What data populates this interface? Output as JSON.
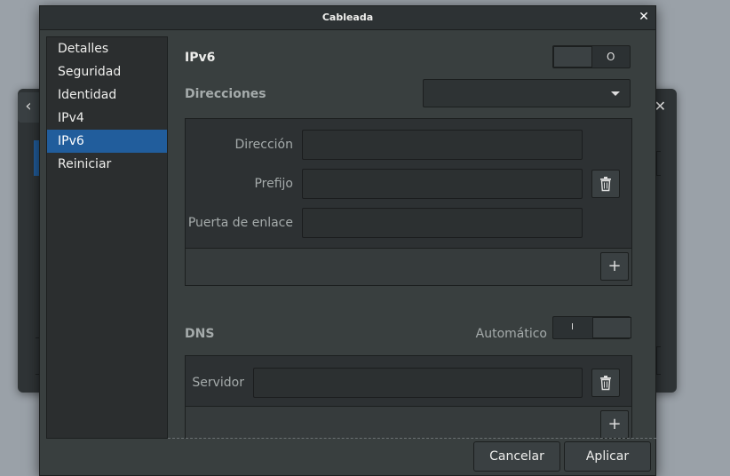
{
  "dialog": {
    "title": "Cableada",
    "close_glyph": "✕"
  },
  "sidebar": {
    "items": [
      {
        "label": "Detalles"
      },
      {
        "label": "Seguridad"
      },
      {
        "label": "Identidad"
      },
      {
        "label": "IPv4"
      },
      {
        "label": "IPv6"
      },
      {
        "label": "Reiniciar"
      }
    ],
    "selected": "IPv6"
  },
  "ipv6": {
    "title": "IPv6",
    "switch_state": "off",
    "switch_off_glyph": "O"
  },
  "addresses": {
    "title": "Direcciones",
    "method_value": "",
    "address_label": "Dirección",
    "address_value": "",
    "prefix_label": "Prefijo",
    "prefix_value": "",
    "gateway_label": "Puerta de enlace",
    "gateway_value": "",
    "add_glyph": "+"
  },
  "dns": {
    "title": "DNS",
    "auto_label": "Automático",
    "auto_state": "on",
    "auto_on_glyph": "I",
    "server_label": "Servidor",
    "server_value": "",
    "add_glyph": "+"
  },
  "footer": {
    "cancel_label": "Cancelar",
    "apply_label": "Aplicar"
  },
  "background_window": {
    "back_glyph": "‹",
    "close_glyph": "✕"
  },
  "icons": {
    "trash": "trash-icon",
    "plus": "plus-icon",
    "dropdown": "chevron-down-icon"
  },
  "colors": {
    "accent": "#215d9c",
    "dialog_bg": "#393f3f",
    "sidebar_bg": "#2b2e2f"
  }
}
